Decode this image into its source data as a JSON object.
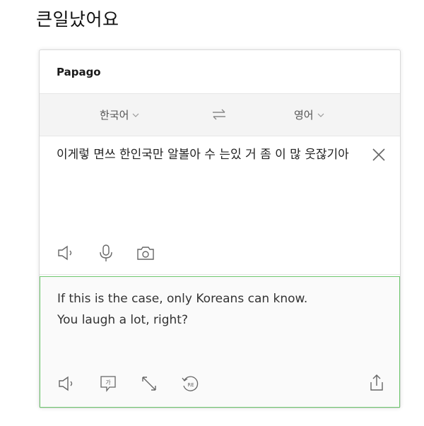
{
  "headline": "큰일났어요",
  "app": {
    "title": "Papago"
  },
  "languages": {
    "source": "한국어",
    "target": "영어"
  },
  "source": {
    "text": "이게렇 면쓰 한인국만 알볼아 수 는있 거 좀 이 많 웃잖기아"
  },
  "result": {
    "text": "If this is the case, only Koreans can know. You laugh a lot, right?"
  },
  "icons": {
    "clear": "close-icon",
    "source_tools": [
      "speaker-icon",
      "microphone-icon",
      "camera-icon"
    ],
    "result_tools": [
      "speaker-icon",
      "honorific-icon",
      "expand-icon",
      "retranslate-icon"
    ],
    "share": "share-icon",
    "swap": "swap-icon",
    "honorific_glyph": "가",
    "retranslate_glyph": "RE"
  },
  "colors": {
    "accent_border": "#6fc86f",
    "lang_bar": "#f4f4f4",
    "icon": "#666666"
  }
}
